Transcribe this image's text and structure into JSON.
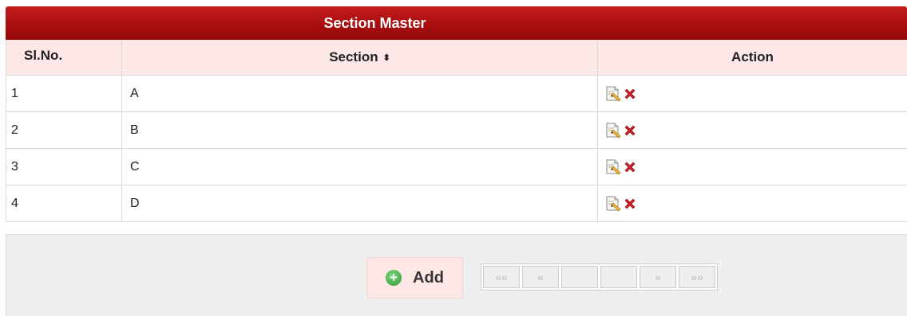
{
  "title": "Section Master",
  "columns": {
    "slno": "Sl.No.",
    "section": "Section",
    "section_sort_icon": "sort-arrows-icon",
    "action": "Action"
  },
  "rows": [
    {
      "slno": "1",
      "section": "A"
    },
    {
      "slno": "2",
      "section": "B"
    },
    {
      "slno": "3",
      "section": "C"
    },
    {
      "slno": "4",
      "section": "D"
    }
  ],
  "icons": {
    "edit": "edit-icon",
    "delete": "delete-icon",
    "add": "plus-circle-icon"
  },
  "footer": {
    "add_label": "Add"
  },
  "pager": {
    "first": "««",
    "prev": "«",
    "page_input": "",
    "total": "",
    "next": "»",
    "last": "»»"
  },
  "colors": {
    "header": "#a80e0e",
    "header_row": "#fde7e7",
    "footer": "#efefef"
  }
}
